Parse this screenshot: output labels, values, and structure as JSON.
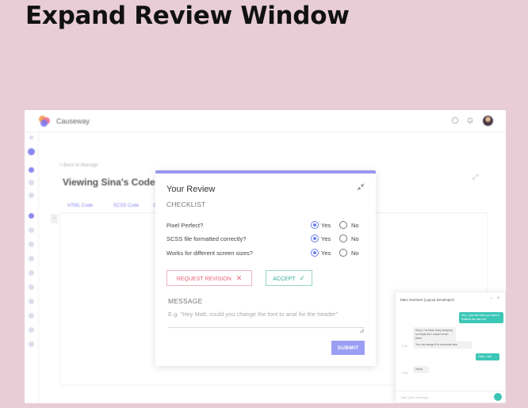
{
  "slide": {
    "title": "Expand Review Window"
  },
  "app": {
    "name": "Causeway",
    "icons": [
      "chat-icon",
      "bell-icon",
      "avatar"
    ]
  },
  "background": {
    "back_link": "< Back to Manage",
    "title": "Viewing Sina's Code",
    "tabs": [
      "HTML Code",
      "SCSS Code",
      "C"
    ]
  },
  "review": {
    "title": "Your Review",
    "checklist_label": "CHECKLIST",
    "yes_label": "Yes",
    "no_label": "No",
    "items": [
      {
        "question": "Pixel Perfect?",
        "answer": "yes"
      },
      {
        "question": "SCSS file formatted correctly?",
        "answer": "yes"
      },
      {
        "question": "Works for different screen sizes?",
        "answer": "yes"
      }
    ],
    "request_revision_label": "REQUEST REVISION",
    "accept_label": "ACCEPT",
    "message_label": "MESSAGE",
    "message_placeholder": "E.g. \"Hey Matt, could you change the font to arial for the header\"",
    "submit_label": "SUBMIT"
  },
  "chat": {
    "header": "Marc Dunham (Layout Developer)",
    "messages": [
      {
        "dir": "out",
        "text": "Hey, I just saw that you haven't finished the last one"
      },
      {
        "dir": "in",
        "text": "Sorry, I've been busy studying for finals but I made it from there"
      },
      {
        "dir": "in",
        "text": "You can assign it to someone else"
      },
      {
        "dir": "out",
        "text": "Okay, I will"
      },
      {
        "dir": "in",
        "text": "Sorry!"
      }
    ],
    "times": [
      "7:41",
      "7:43"
    ],
    "input_placeholder": "Type your message..."
  },
  "colors": {
    "accent": "#9a97f0",
    "revision": "#e8647c",
    "accept": "#39ae95",
    "submit": "#9a9ff4",
    "chat_bubble": "#3cc6b6",
    "slide_bg": "#e8cdd6"
  }
}
